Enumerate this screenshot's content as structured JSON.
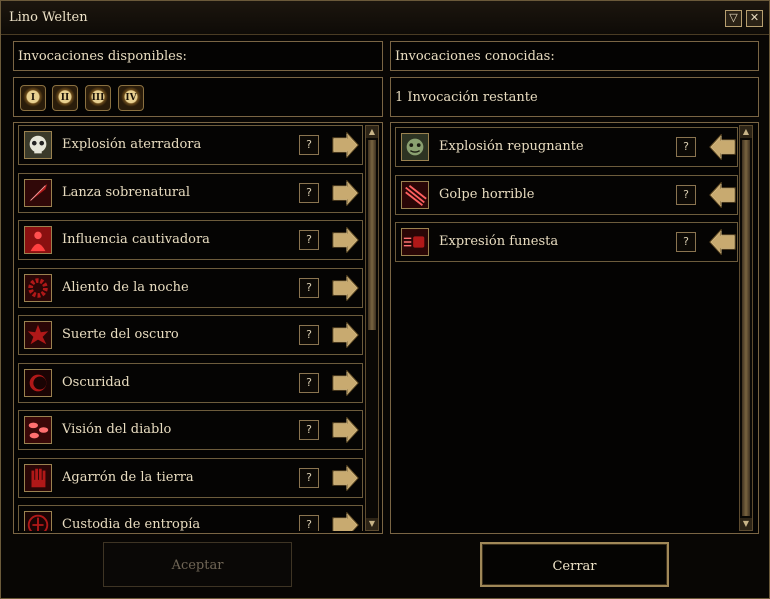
{
  "window": {
    "title": "Lino Welten"
  },
  "left": {
    "header": "Invocaciones disponibles:",
    "grade_tabs": [
      "I",
      "II",
      "III",
      "IV"
    ],
    "items": [
      {
        "label": "Explosión aterradora",
        "icon": "skull-icon"
      },
      {
        "label": "Lanza sobrenatural",
        "icon": "spear-icon"
      },
      {
        "label": "Influencia cautivadora",
        "icon": "figure-icon"
      },
      {
        "label": "Aliento de la noche",
        "icon": "ring-icon"
      },
      {
        "label": "Suerte del oscuro",
        "icon": "burst-icon"
      },
      {
        "label": "Oscuridad",
        "icon": "crescent-icon"
      },
      {
        "label": "Visión del diablo",
        "icon": "eyes-icon"
      },
      {
        "label": "Agarrón de la tierra",
        "icon": "hand-icon"
      },
      {
        "label": "Custodia de entropía",
        "icon": "rune-icon"
      }
    ]
  },
  "right": {
    "header": "Invocaciones conocidas:",
    "remaining": "1 Invocación restante",
    "items": [
      {
        "label": "Explosión repugnante",
        "icon": "face-icon"
      },
      {
        "label": "Golpe horrible",
        "icon": "claw-icon"
      },
      {
        "label": "Expresión funesta",
        "icon": "fist-icon"
      }
    ]
  },
  "help_symbol": "?",
  "buttons": {
    "accept": "Aceptar",
    "close": "Cerrar"
  },
  "colors": {
    "border": "#7a6544",
    "accent": "#a08858",
    "icon_red": "#b01818"
  }
}
